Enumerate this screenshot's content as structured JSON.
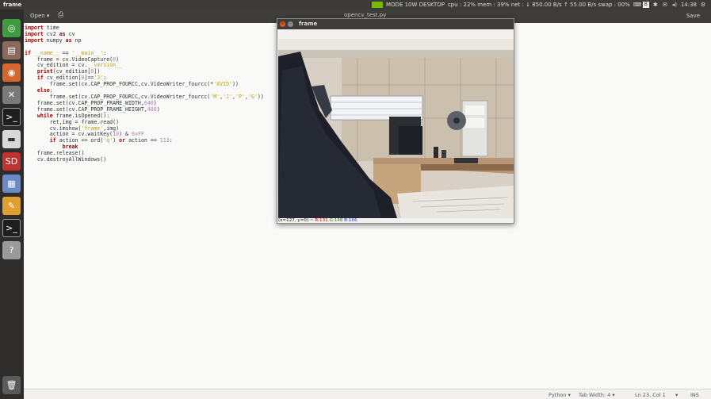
{
  "panel": {
    "app_title": "frame",
    "mode": "MODE 10W DESKTOP",
    "stats": "cpu : 22% mem : 39% net : ↓ 850.00 B/s ↑ 55.00 B/s swap : 00%",
    "bluetooth": "B",
    "time": "14:38",
    "icons": [
      "nvidia-logo-icon",
      "keyboard-icon",
      "bluetooth-icon",
      "mail-icon",
      "volume-icon",
      "gear-icon"
    ]
  },
  "launcher": {
    "items": [
      "ubuntu-dash-icon",
      "files-icon",
      "app-store-icon",
      "system-settings-icon",
      "terminal-icon",
      "drive-icon",
      "sd-card-icon",
      "workspace-switcher-icon",
      "text-editor-icon",
      "terminal-icon",
      "help-icon",
      "trash-icon"
    ]
  },
  "header": {
    "open_label": "Open ▾",
    "doc_title": "opencv_test.py",
    "save_label": "Save"
  },
  "editor": {
    "lines": [
      "import time",
      "import cv2 as cv",
      "import numpy as np",
      "",
      "if __name__ == '__main__':",
      "    frame = cv.VideoCapture(0)",
      "    cv_edition = cv.__version__",
      "    print(cv_edition[0])",
      "    if cv_edition[0]=='3':",
      "        frame.set(cv.CAP_PROP_FOURCC,cv.VideoWriter_fourcc(*'XVID'))",
      "    else:",
      "        frame.set(cv.CAP_PROP_FOURCC,cv.VideoWriter_fourcc('M','J','P','G'))",
      "    frame.set(cv.CAP_PROP_FRAME_WIDTH,640)",
      "    frame.set(cv.CAP_PROP_FRAME_HEIGHT,480)",
      "    while frame.isOpened():",
      "        ret,img = frame.read()",
      "        cv.imshow('frame',img)",
      "        action = cv.waitKey(10) & 0xFF",
      "        if action == ord('q') or action == 113:",
      "            break",
      "    frame.release()",
      "    cv.destroyAllWindows()"
    ]
  },
  "cv_window": {
    "title": "frame",
    "pixel_coords": "(x=127, y=0) ~",
    "r": "R:131",
    "g": "G:148",
    "b": "B:166"
  },
  "statusbar": {
    "language": "Python ▾",
    "tab_width": "Tab Width: 4 ▾",
    "position": "Ln 23, Col 1",
    "arrow": "▾",
    "mode": "INS"
  },
  "colors": {
    "panel_bg": "#3c3b37",
    "launcher_bg": "#2f2c2c",
    "editor_bg": "#f9f9f8",
    "close_button": "#e9541f",
    "nvidia": "#76b900"
  }
}
